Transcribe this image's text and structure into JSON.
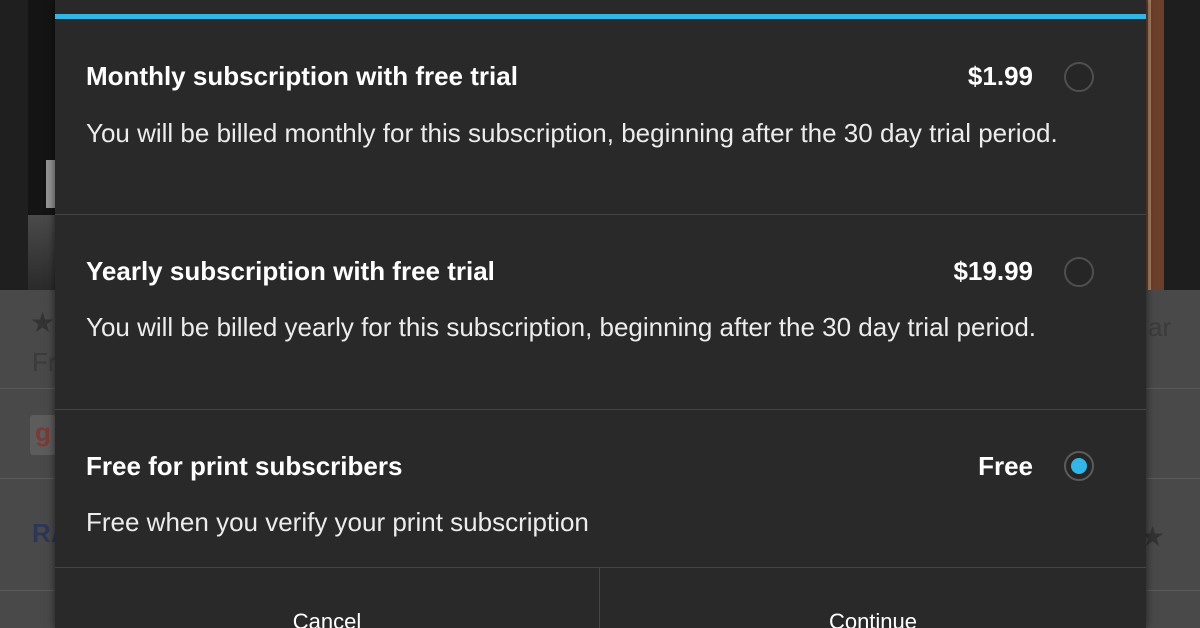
{
  "background": {
    "right_fragment": "ar",
    "left_fragment": "Fr",
    "left_label": "RA"
  },
  "dialog": {
    "options": [
      {
        "title": "Monthly subscription with free trial",
        "price": "$1.99",
        "description": "You will be billed monthly for this subscription, beginning after the 30 day trial period.",
        "selected": false
      },
      {
        "title": "Yearly subscription with free trial",
        "price": "$19.99",
        "description": "You will be billed yearly for this subscription, beginning after the 30 day trial period.",
        "selected": false
      },
      {
        "title": "Free for print subscribers",
        "price": "Free",
        "description": "Free when you verify your print subscription",
        "selected": true
      }
    ],
    "buttons": {
      "cancel": "Cancel",
      "continue": "Continue"
    }
  },
  "colors": {
    "accent": "#33b5e5",
    "dialog_background": "#292929",
    "text": "#ffffff"
  },
  "icons": {
    "radio_unchecked": "radio-button-unchecked",
    "radio_checked": "radio-button-checked",
    "background_star": "star-icon",
    "background_google": "google-plus-icon"
  }
}
